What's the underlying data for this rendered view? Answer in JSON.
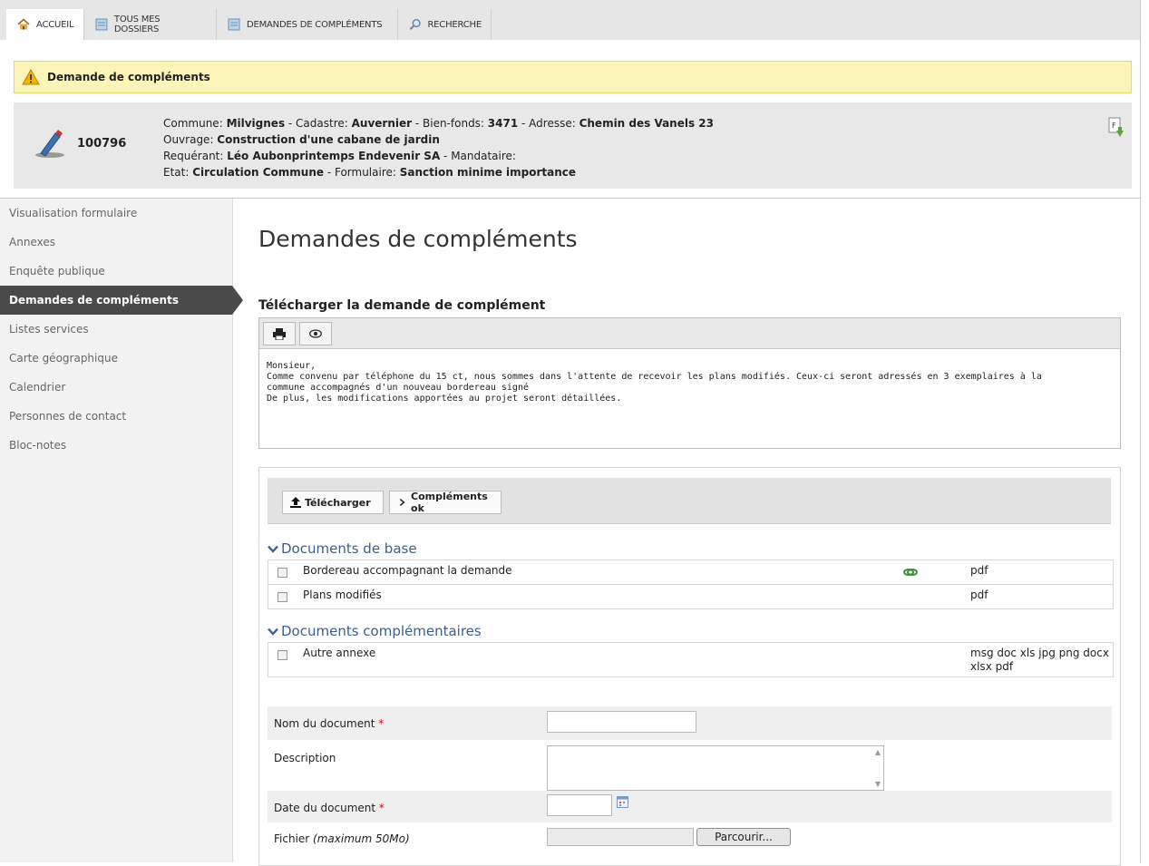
{
  "tabs": [
    {
      "label": "ACCUEIL",
      "icon": "home-icon"
    },
    {
      "label": "TOUS MES DOSSIERS",
      "icon": "folder-icon"
    },
    {
      "label": "DEMANDES DE COMPLÉMENTS",
      "icon": "folder-icon"
    },
    {
      "label": "RECHERCHE",
      "icon": "magnifier-icon"
    }
  ],
  "alert": {
    "text": "Demande de compléments"
  },
  "dossier": {
    "number": "100796",
    "commune_label": "Commune: ",
    "commune": "Milvignes",
    "cadastre_label": " - Cadastre: ",
    "cadastre": "Auvernier",
    "bienfonds_label": " - Bien-fonds: ",
    "bienfonds": "3471",
    "adresse_label": " - Adresse: ",
    "adresse": "Chemin des Vanels 23",
    "ouvrage_label": "Ouvrage: ",
    "ouvrage": "Construction d'une cabane de jardin",
    "requerant_label": "Requérant: ",
    "requerant": "Léo Aubonprintemps Endevenir SA",
    "mandataire_label": " - Mandataire:",
    "etat_label": "Etat: ",
    "etat": "Circulation Commune",
    "formulaire_label": " - Formulaire: ",
    "formulaire": "Sanction minime importance"
  },
  "sidebar": {
    "items": [
      {
        "label": "Visualisation formulaire",
        "active": false
      },
      {
        "label": "Annexes",
        "active": false
      },
      {
        "label": "Enquête publique",
        "active": false
      },
      {
        "label": "Demandes de compléments",
        "active": true
      },
      {
        "label": "Listes services",
        "active": false
      },
      {
        "label": "Carte géographique",
        "active": false
      },
      {
        "label": "Calendrier",
        "active": false
      },
      {
        "label": "Personnes de contact",
        "active": false
      },
      {
        "label": "Bloc-notes",
        "active": false
      }
    ]
  },
  "main": {
    "title": "Demandes de compléments",
    "download_title": "Télécharger la demande de complément",
    "letter": {
      "line1": "Monsieur,",
      "line2": "Comme convenu par téléphone du 15 ct, nous sommes dans l'attente de recevoir les plans modifiés. Ceux-ci seront adressés en 3 exemplaires à la",
      "line3": "commune accompagnés d'un nouveau bordereau signé",
      "line4": "De plus, les modifications apportées au projet seront détaillées."
    },
    "actions": {
      "upload": "Télécharger",
      "ok": "Compléments ok"
    },
    "base_docs": {
      "title": "Documents de base",
      "rows": [
        {
          "label": "Bordereau accompagnant la demande",
          "ext": "pdf",
          "has_icon": true
        },
        {
          "label": "Plans modifiés",
          "ext": "pdf",
          "has_icon": false
        }
      ]
    },
    "extra_docs": {
      "title": "Documents complémentaires",
      "rows": [
        {
          "label": "Autre annexe",
          "ext": "msg doc xls jpg png docx xlsx pdf"
        }
      ]
    },
    "form": {
      "name_label": "Nom du document",
      "required_mark": "*",
      "description_label": "Description",
      "date_label": "Date du document",
      "file_label": "Fichier",
      "file_hint": "(maximum 50Mo)",
      "browse": "Parcourir..."
    }
  },
  "colors": {
    "accent": "#3a5f8f",
    "alert_bg": "#fcf5b8",
    "active_nav": "#4a4a4a"
  }
}
